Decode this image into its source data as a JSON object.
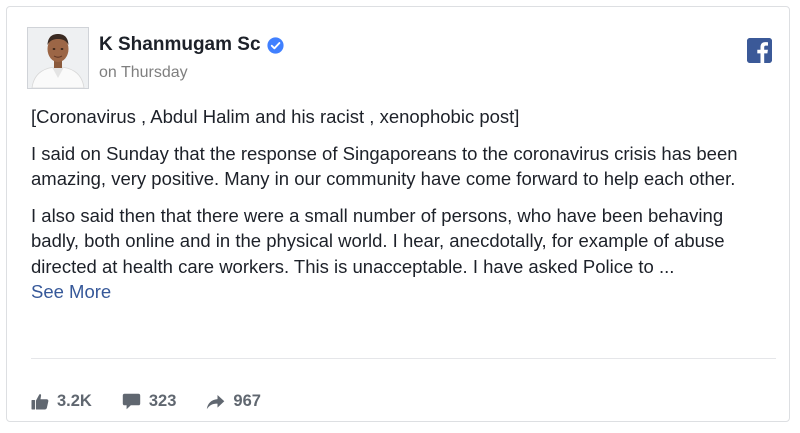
{
  "post": {
    "author": "K Shanmugam Sc",
    "timestamp": "on Thursday",
    "paragraphs": [
      "[Coronavirus , Abdul Halim and his racist , xenophobic post]",
      "I said on Sunday that the response of Singaporeans to the coronavirus crisis has been amazing, very positive. Many in our community have come forward to help each other.",
      "I also said then that there were a small number of persons, who have been behaving badly, both online and in the physical world. I hear, anecdotally, for example of abuse directed at health care workers. This is unacceptable. I have asked Police to ..."
    ],
    "see_more": "See More"
  },
  "stats": {
    "likes": "3.2K",
    "comments": "323",
    "shares": "967"
  },
  "icons": {
    "verified": "verified-badge-icon",
    "brand": "facebook-logo-icon",
    "like": "thumbs-up-icon",
    "comment": "comment-bubble-icon",
    "share": "share-arrow-icon"
  },
  "colors": {
    "brand": "#3b5998",
    "verified": "#4080ff",
    "link": "#365899",
    "muted": "#606770"
  }
}
